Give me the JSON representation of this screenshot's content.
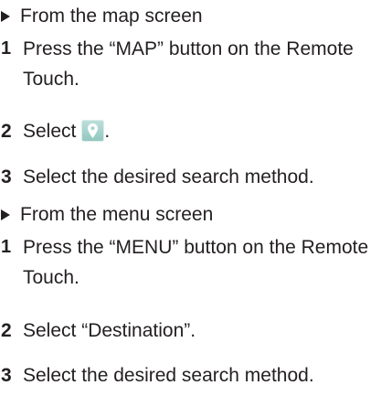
{
  "sections": [
    {
      "heading": "From the map screen",
      "steps": [
        {
          "number": "1",
          "text": "Press the “MAP” button on the Remote Touch."
        },
        {
          "number": "2",
          "text_before": "Select",
          "text_after": ".",
          "icon": "map-pin-icon"
        },
        {
          "number": "3",
          "text": "Select the desired search method."
        }
      ]
    },
    {
      "heading": "From the menu screen",
      "steps": [
        {
          "number": "1",
          "text": "Press the “MENU” button on the Remote Touch."
        },
        {
          "number": "2",
          "text": "Select “Destination”."
        },
        {
          "number": "3",
          "text": "Select the desired search method."
        }
      ]
    }
  ],
  "colors": {
    "text": "#231f20",
    "icon_bg": "#a8d4cd",
    "icon_pin": "#ffffff"
  }
}
